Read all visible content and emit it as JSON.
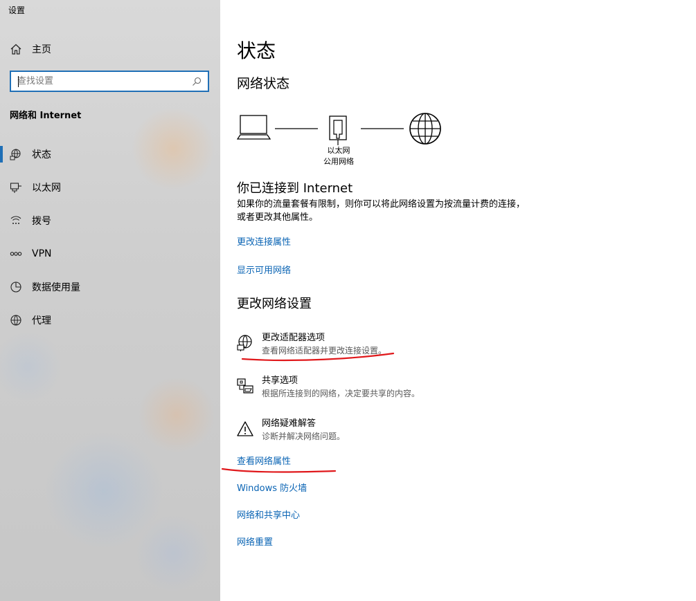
{
  "app": {
    "title": "设置"
  },
  "sidebar": {
    "home_label": "主页",
    "search": {
      "placeholder": "查找设置",
      "value": ""
    },
    "section_title": "网络和 Internet",
    "items": [
      {
        "label": "状态",
        "icon": "network-status-icon",
        "active": true
      },
      {
        "label": "以太网",
        "icon": "ethernet-icon",
        "active": false
      },
      {
        "label": "拨号",
        "icon": "dialup-icon",
        "active": false
      },
      {
        "label": "VPN",
        "icon": "vpn-icon",
        "active": false
      },
      {
        "label": "数据使用量",
        "icon": "data-usage-icon",
        "active": false
      },
      {
        "label": "代理",
        "icon": "proxy-globe-icon",
        "active": false
      }
    ]
  },
  "main": {
    "title": "状态",
    "network_status_title": "网络状态",
    "diagram": {
      "adapter_label": "以太网",
      "network_type": "公用网络"
    },
    "connected_title": "你已连接到 Internet",
    "connected_desc": "如果你的流量套餐有限制，则你可以将此网络设置为按流量计费的连接，或者更改其他属性。",
    "links_top": [
      "更改连接属性",
      "显示可用网络"
    ],
    "change_title": "更改网络设置",
    "options": [
      {
        "label": "更改适配器选项",
        "desc": "查看网络适配器并更改连接设置。",
        "icon": "adapter-icon"
      },
      {
        "label": "共享选项",
        "desc": "根据所连接到的网络，决定要共享的内容。",
        "icon": "sharing-icon"
      },
      {
        "label": "网络疑难解答",
        "desc": "诊断并解决网络问题。",
        "icon": "warning-icon"
      }
    ],
    "links_bottom": [
      "查看网络属性",
      "Windows 防火墙",
      "网络和共享中心",
      "网络重置"
    ]
  },
  "colors": {
    "accent": "#1f6fb6",
    "link": "#0a64b4",
    "annotation": "#e0181b"
  }
}
